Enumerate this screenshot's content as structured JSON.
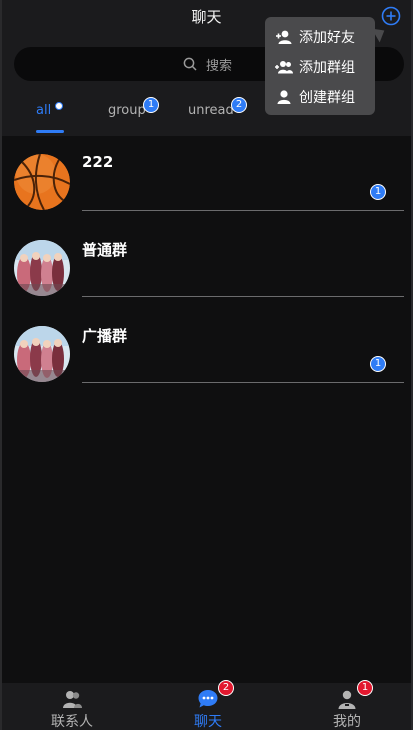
{
  "header": {
    "title": "聊天"
  },
  "search": {
    "placeholder": "搜索"
  },
  "tabs": [
    {
      "label": "all",
      "badge": ""
    },
    {
      "label": "group",
      "badge": "1"
    },
    {
      "label": "unread",
      "badge": "2"
    }
  ],
  "chats": [
    {
      "name": "222",
      "unread": "1",
      "avatar": "basketball"
    },
    {
      "name": "普通群",
      "unread": "",
      "avatar": "group-photo"
    },
    {
      "name": "广播群",
      "unread": "1",
      "avatar": "group-photo"
    }
  ],
  "menu": {
    "items": [
      {
        "label": "添加好友",
        "icon": "add-user-icon"
      },
      {
        "label": "添加群组",
        "icon": "add-group-icon"
      },
      {
        "label": "创建群组",
        "icon": "create-group-icon"
      }
    ]
  },
  "bottom_nav": [
    {
      "label": "联系人",
      "icon": "contacts-icon",
      "badge": ""
    },
    {
      "label": "聊天",
      "icon": "chat-bubble-icon",
      "badge": "2"
    },
    {
      "label": "我的",
      "icon": "profile-icon",
      "badge": "1"
    }
  ],
  "colors": {
    "accent": "#2f7cf6",
    "badge_red": "#e2182f",
    "background": "#0f0f10",
    "bar": "#1b1b1d"
  }
}
